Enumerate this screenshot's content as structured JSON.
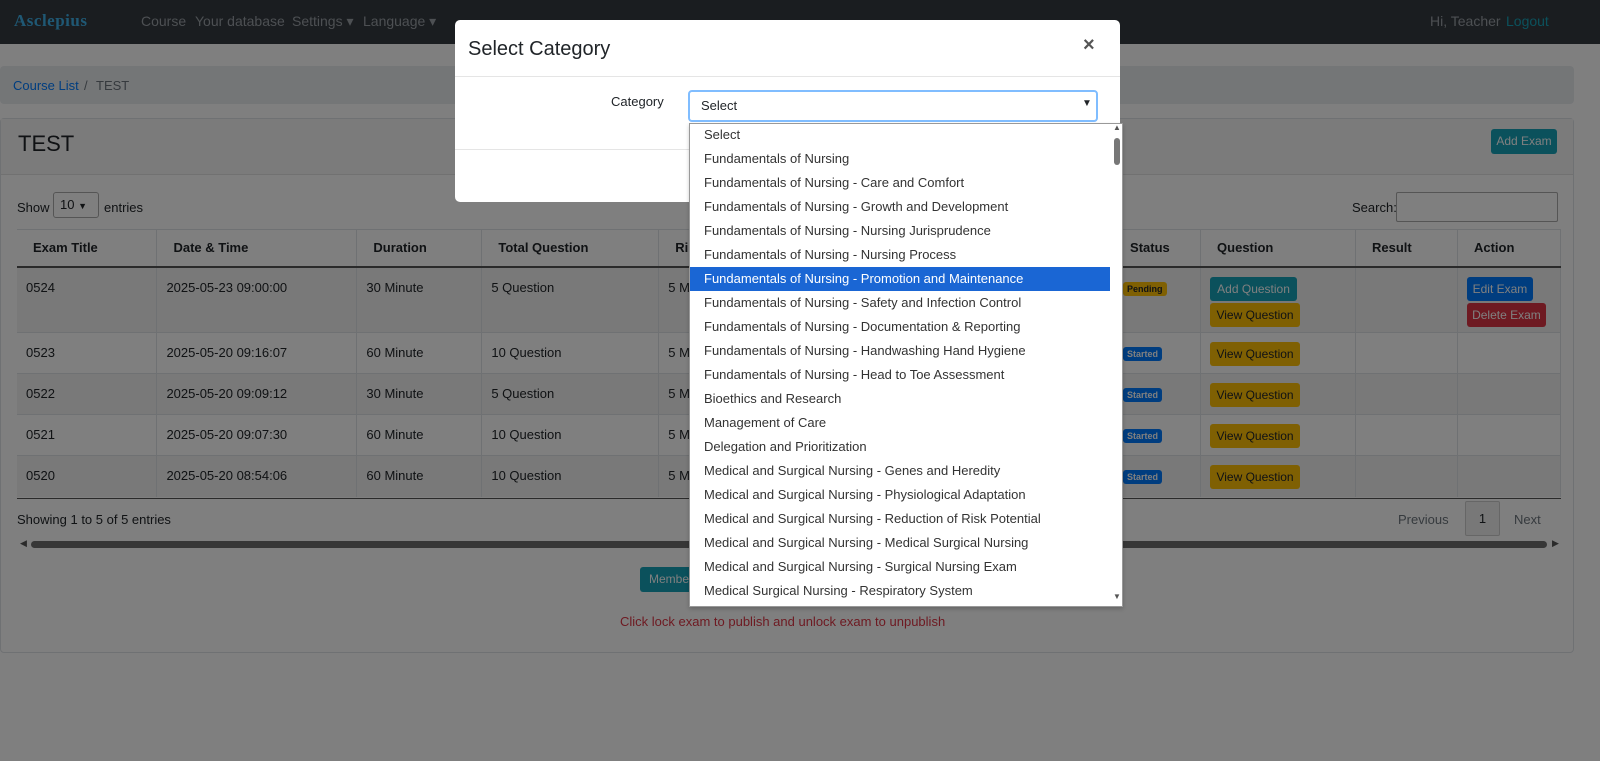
{
  "navbar": {
    "brand": "Asclepius",
    "links": [
      "Course",
      "Your database",
      "Settings ▾",
      "Language ▾"
    ],
    "greeting": "Hi, Teacher",
    "logout": "Logout"
  },
  "breadcrumb": {
    "course_list": "Course List",
    "separator": "/",
    "current": "TEST"
  },
  "card": {
    "title": "TEST",
    "add_exam": "Add Exam"
  },
  "table_controls": {
    "show": "Show",
    "entries": "entries",
    "length": "10",
    "search_label": "Search:"
  },
  "table": {
    "headers": [
      "Exam Title",
      "Date & Time",
      "Duration",
      "Total Question",
      "Ri",
      "Status",
      "Question",
      "Result",
      "Action"
    ],
    "rows": [
      {
        "title": "0524",
        "datetime": "2025-05-23 09:00:00",
        "duration": "30 Minute",
        "total": "5 Question",
        "ri": "5 M",
        "status": "Pending"
      },
      {
        "title": "0523",
        "datetime": "2025-05-20 09:16:07",
        "duration": "60 Minute",
        "total": "10 Question",
        "ri": "5 M",
        "status": "Started"
      },
      {
        "title": "0522",
        "datetime": "2025-05-20 09:09:12",
        "duration": "30 Minute",
        "total": "5 Question",
        "ri": "5 M",
        "status": "Started"
      },
      {
        "title": "0521",
        "datetime": "2025-05-20 09:07:30",
        "duration": "60 Minute",
        "total": "10 Question",
        "ri": "5 M",
        "status": "Started"
      },
      {
        "title": "0520",
        "datetime": "2025-05-20 08:54:06",
        "duration": "60 Minute",
        "total": "10 Question",
        "ri": "5 M",
        "status": "Started"
      }
    ],
    "add_question": "Add Question",
    "view_question": "View Question",
    "edit_exam": "Edit Exam",
    "delete_exam": "Delete Exam"
  },
  "pagination": {
    "info": "Showing 1 to 5 of 5 entries",
    "previous": "Previous",
    "page": "1",
    "next": "Next"
  },
  "member_button": "Member",
  "note": "Click lock exam to publish and unlock exam to unpublish",
  "modal": {
    "title": "Select Category",
    "close": "×",
    "category_label": "Category",
    "selected": "Select"
  },
  "dropdown": {
    "options": [
      "Select",
      "Fundamentals of Nursing",
      "Fundamentals of Nursing - Care and Comfort",
      "Fundamentals of Nursing - Growth and Development",
      "Fundamentals of Nursing - Nursing Jurisprudence",
      "Fundamentals of Nursing - Nursing Process",
      "Fundamentals of Nursing - Promotion and Maintenance",
      "Fundamentals of Nursing - Safety and Infection Control",
      "Fundamentals of Nursing - Documentation & Reporting",
      "Fundamentals of Nursing - Handwashing Hand Hygiene",
      "Fundamentals of Nursing - Head to Toe Assessment",
      "Bioethics and Research",
      "Management of Care",
      "Delegation and Prioritization",
      "Medical and Surgical Nursing - Genes and Heredity",
      "Medical and Surgical Nursing - Physiological Adaptation",
      "Medical and Surgical Nursing - Reduction of Risk Potential",
      "Medical and Surgical Nursing - Medical Surgical Nursing",
      "Medical and Surgical Nursing - Surgical Nursing Exam",
      "Medical Surgical Nursing - Respiratory System"
    ],
    "highlighted": "Fundamentals of Nursing - Promotion and Maintenance"
  }
}
